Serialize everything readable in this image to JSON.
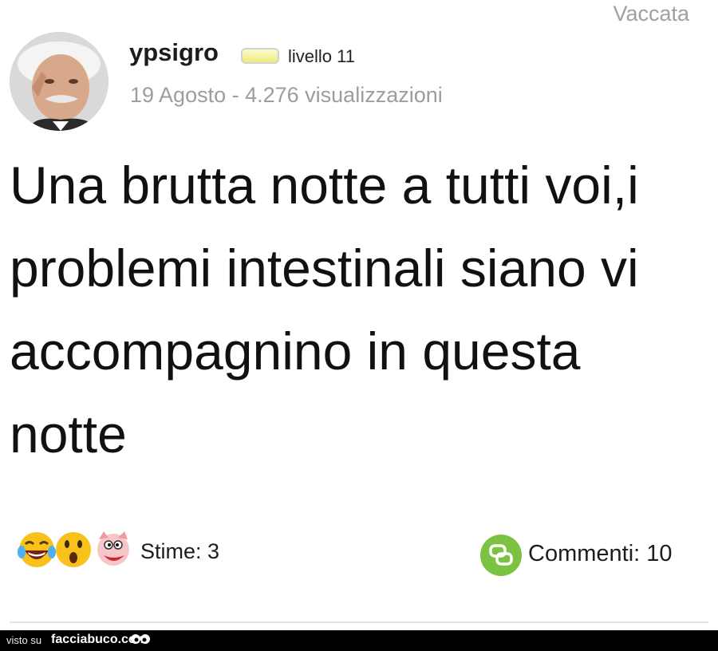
{
  "post": {
    "category": "Vaccata",
    "author": {
      "username": "ypsigro",
      "level_label": "livello 11"
    },
    "meta": "19 Agosto - 4.276 visualizzazioni",
    "text": "Una brutta notte a tutti voi,i problemi intestinali siano vi accompagnino in questa notte",
    "reactions": {
      "emojis": [
        "laughing-tears-emoji",
        "surprised-emoji",
        "pig-emoji"
      ],
      "label": "Stime: 3"
    },
    "comments": {
      "icon": "comment-icon",
      "label": "Commenti: 10"
    }
  },
  "footer": {
    "prefix": "visto su",
    "brand": "facciabuco.com"
  },
  "colors": {
    "comment_green": "#7cc242",
    "meta_gray": "#9d9d9d",
    "footer_bg": "#000000"
  }
}
